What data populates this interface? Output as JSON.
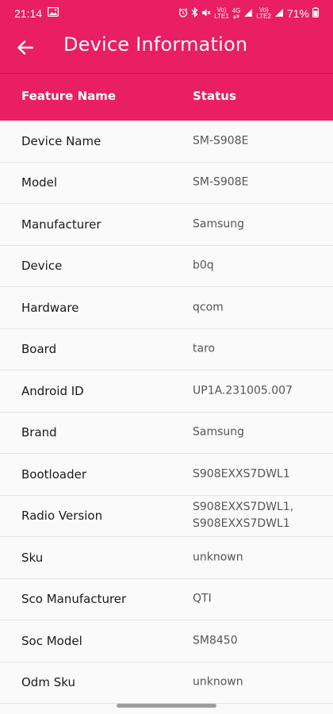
{
  "statusbar": {
    "time": "21:14",
    "battery": "71%",
    "net1_top": "Vo)",
    "net1_bottom": "LTE1",
    "net2_top": "4G",
    "net3_top": "Vo)",
    "net3_bottom": "LTE2"
  },
  "appbar": {
    "title": "Device Information"
  },
  "table": {
    "header": {
      "feature": "Feature Name",
      "status": "Status"
    },
    "rows": [
      {
        "name": "Device Name",
        "value": "SM-S908E"
      },
      {
        "name": "Model",
        "value": "SM-S908E"
      },
      {
        "name": "Manufacturer",
        "value": "Samsung"
      },
      {
        "name": "Device",
        "value": "b0q"
      },
      {
        "name": "Hardware",
        "value": "qcom"
      },
      {
        "name": "Board",
        "value": "taro"
      },
      {
        "name": "Android ID",
        "value": "UP1A.231005.007"
      },
      {
        "name": "Brand",
        "value": "Samsung"
      },
      {
        "name": "Bootloader",
        "value": "S908EXXS7DWL1"
      },
      {
        "name": "Radio Version",
        "value": "S908EXXS7DWL1,\nS908EXXS7DWL1"
      },
      {
        "name": "Sku",
        "value": "unknown"
      },
      {
        "name": "Sco Manufacturer",
        "value": "QTI"
      },
      {
        "name": "Soc Model",
        "value": "SM8450"
      },
      {
        "name": "Odm Sku",
        "value": "unknown"
      }
    ]
  },
  "colors": {
    "accent": "#e91e63"
  },
  "icons": [
    "back-arrow-icon",
    "image-icon",
    "alarm-icon",
    "bluetooth-icon",
    "mute-icon",
    "wifi-icon",
    "signal-icon",
    "battery-icon"
  ]
}
